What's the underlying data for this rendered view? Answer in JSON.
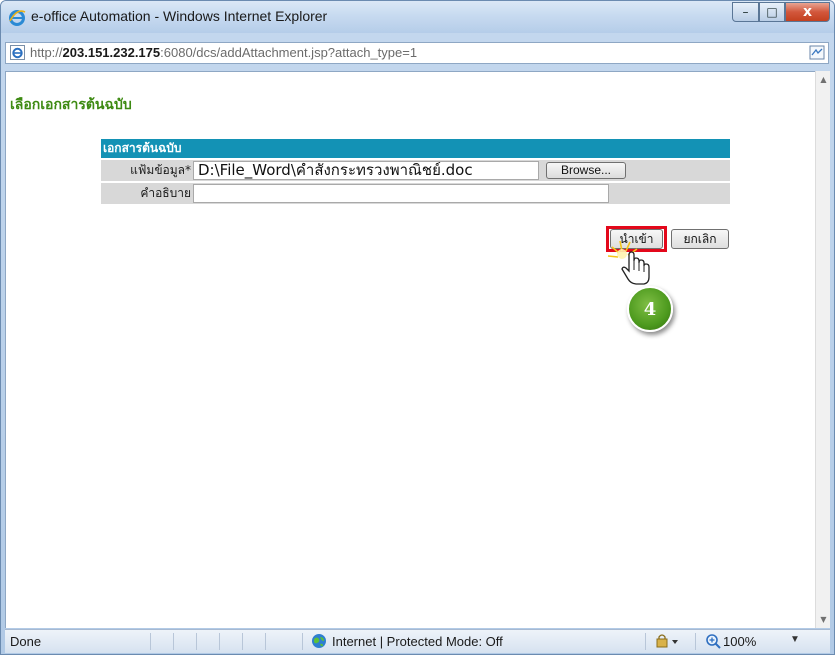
{
  "window": {
    "title": "e-office Automation - Windows Internet Explorer",
    "minimize_glyph": "–",
    "maximize_glyph": "□",
    "close_glyph": "x"
  },
  "address": {
    "prefix": "http://",
    "host": "203.151.232.175",
    "rest": ":6080/dcs/addAttachment.jsp?attach_type=1"
  },
  "page": {
    "heading": "เลือกเอกสารต้นฉบับ",
    "form_header": "เอกสารต้นฉบับ",
    "file_label": "แฟ้มข้อมูล*",
    "file_value": "D:\\File_Word\\คำสั่งกระทรวงพาณิชย์.doc",
    "browse_label": "Browse...",
    "description_label": "คำอธิบาย",
    "description_value": "",
    "import_label": "นำเข้า",
    "cancel_label": "ยกเลิก"
  },
  "annotation": {
    "step_number": "4",
    "highlight_color": "#e3081b",
    "badge_color": "#4d9a1e"
  },
  "status": {
    "text": "Done",
    "zone": "Internet | Protected Mode: Off",
    "zoom": "100%"
  },
  "colors": {
    "form_header_bg": "#1392b5",
    "heading_text": "#3d8a12"
  }
}
